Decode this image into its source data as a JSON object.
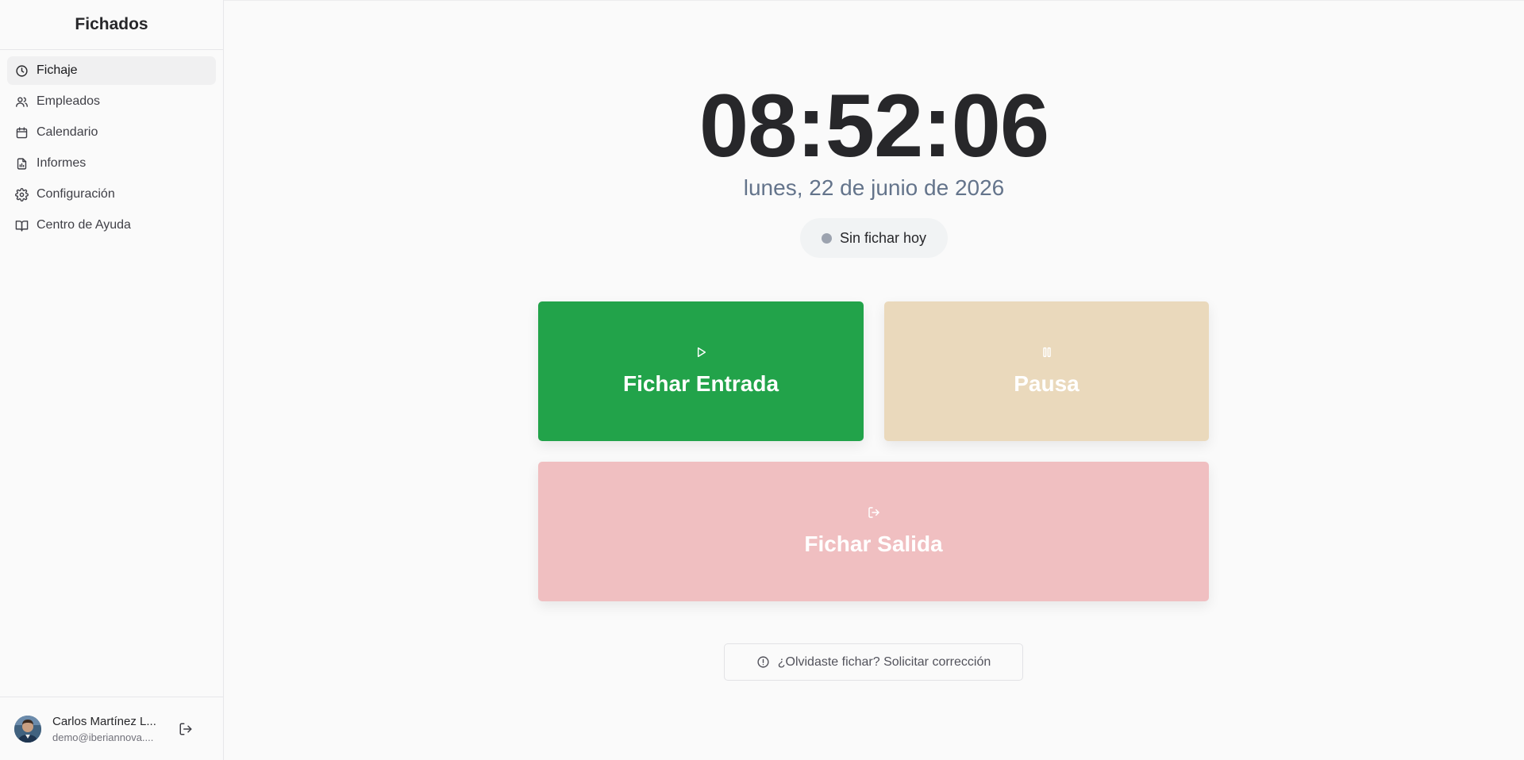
{
  "sidebar": {
    "brand": "Fichados",
    "items": [
      {
        "label": "Fichaje",
        "icon": "clock-icon",
        "active": true
      },
      {
        "label": "Empleados",
        "icon": "users-icon"
      },
      {
        "label": "Calendario",
        "icon": "calendar-icon"
      },
      {
        "label": "Informes",
        "icon": "file-chart-icon"
      },
      {
        "label": "Configuración",
        "icon": "gear-icon"
      },
      {
        "label": "Centro de Ayuda",
        "icon": "book-icon"
      }
    ]
  },
  "user": {
    "name": "Carlos Martínez L...",
    "email": "demo@iberiannova...."
  },
  "main": {
    "time": "08:52:06",
    "date": "lunes, 22 de junio de 2026",
    "status": "Sin fichar hoy",
    "actions": {
      "entrada": "Fichar Entrada",
      "pausa": "Pausa",
      "salida": "Fichar Salida"
    },
    "correction": "¿Olvidaste fichar? Solicitar corrección"
  },
  "colors": {
    "entrada": "#22a34a",
    "pausa": "#ead9bc",
    "salida": "#f0bfc1",
    "status_dot": "#9ca3af"
  }
}
